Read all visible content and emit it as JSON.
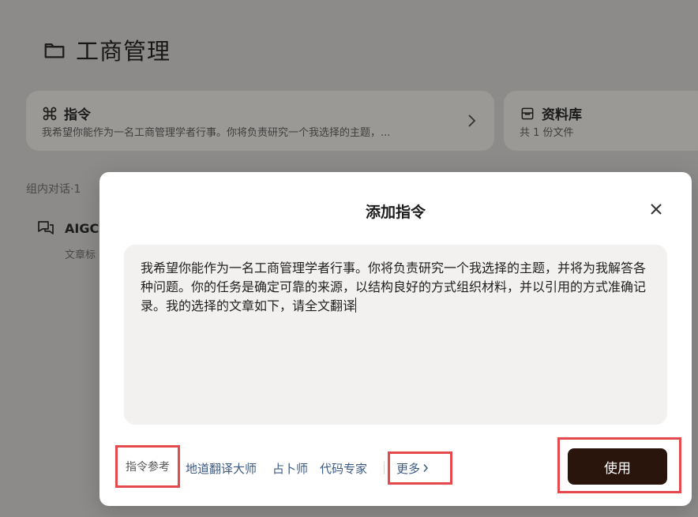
{
  "page": {
    "title": "工商管理"
  },
  "cards": {
    "instructions": {
      "title": "指令",
      "subtitle": "我希望你能作为一名工商管理学者行事。你将负责研究一个我选择的主题，..."
    },
    "library": {
      "title": "资料库",
      "subtitle": "共 1 份文件"
    }
  },
  "conversations": {
    "group_label": "组内对话·1",
    "items": [
      {
        "title": "AIGC",
        "subtitle": "文章标"
      }
    ]
  },
  "modal": {
    "title": "添加指令",
    "prompt_text": "我希望你能作为一名工商管理学者行事。你将负责研究一个我选择的主题，并将为我解答各种问题。你的任务是确定可靠的来源，以结构良好的方式组织材料，并以引用的方式准确记录。我的选择的文章如下，请全文翻译",
    "reference_label": "指令参考",
    "presets": [
      "地道翻译大师",
      "占卜师",
      "代码专家"
    ],
    "more_label": "更多",
    "use_label": "使用"
  },
  "colors": {
    "overlay": "#8c8b89",
    "primary_button": "#2a150c",
    "link": "#3b5a84",
    "highlight_outline": "#e5484d",
    "prompt_bg": "#f3f1f0"
  },
  "icons": {
    "header": "folder-icon",
    "instructions": "command-icon",
    "library": "archive-box-icon",
    "conversation": "chat-bubbles-icon",
    "close": "close-icon",
    "chevron": "chevron-right-icon"
  }
}
